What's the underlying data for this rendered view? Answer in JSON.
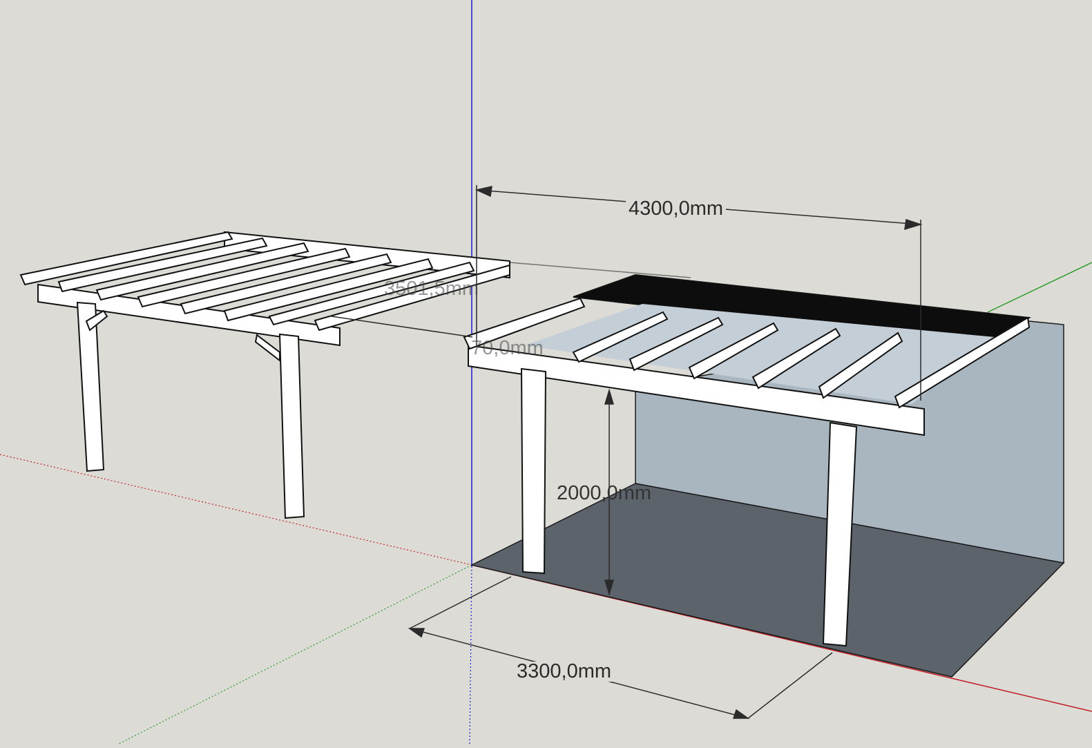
{
  "scene": {
    "background_color": "#dcdbd6",
    "axes": {
      "blue_axis_color": "#1a1ac8",
      "red_axis_color": "#c0202a",
      "green_axis_color": "#2a9a2a"
    },
    "ground_color": "#5d636b",
    "wall_color": "#a9b6bf",
    "roof_panel_color": "#b8c3cc",
    "timber_color": "#ffffff",
    "line_color": "#111111"
  },
  "dimensions": {
    "width_top": "4300,0mm",
    "depth_hidden": "3501,5mm",
    "beam_height": "70,0mm",
    "clear_height": "2000,0mm",
    "depth_bottom": "3300,0mm"
  }
}
